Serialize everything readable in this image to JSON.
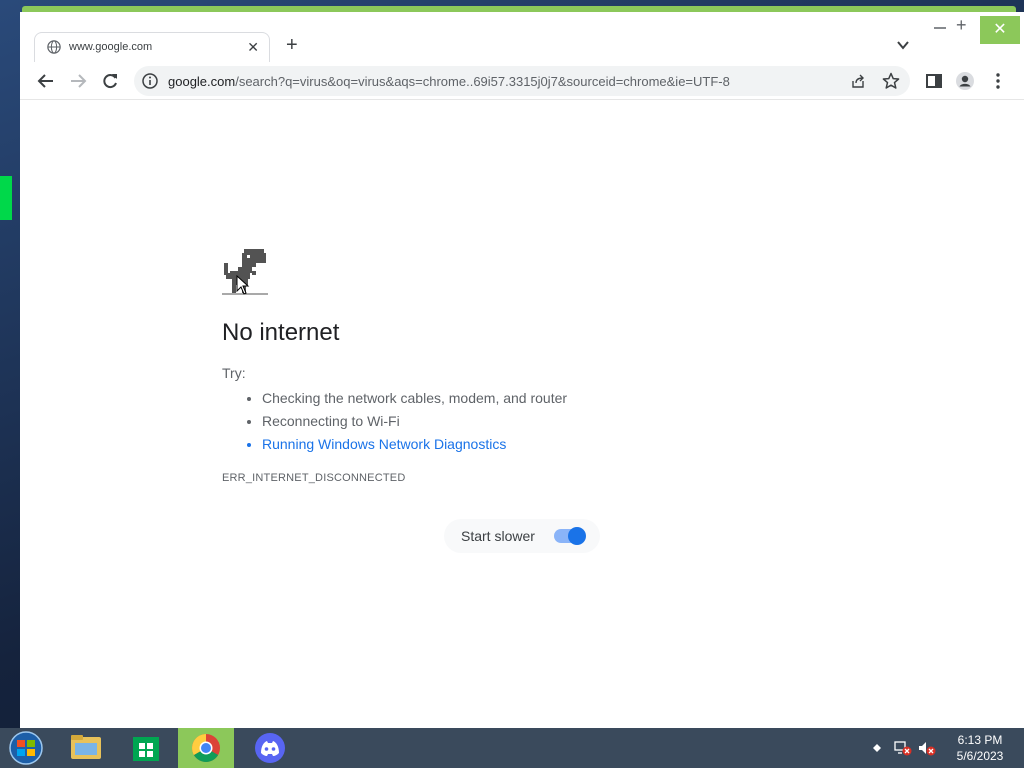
{
  "browser": {
    "tab": {
      "title": "www.google.com",
      "close_glyph": "✕",
      "icon": "globe-icon"
    },
    "new_tab_glyph": "+",
    "window_controls": {
      "maximize_glyph": "+",
      "close_glyph": "✕"
    },
    "address_bar": {
      "host": "google.com",
      "path": "/search?q=virus&oq=virus&aqs=chrome..69i57.3315j0j7&sourceid=chrome&ie=UTF-8"
    },
    "accent": "#1a73e8"
  },
  "error_page": {
    "title": "No internet",
    "try_label": "Try:",
    "suggestions": [
      "Checking the network cables, modem, and router",
      "Reconnecting to Wi-Fi",
      "Running Windows Network Diagnostics"
    ],
    "error_code": "ERR_INTERNET_DISCONNECTED",
    "start_slower": {
      "label": "Start slower",
      "enabled": true
    }
  },
  "taskbar": {
    "apps": [
      "start-orb",
      "file-explorer",
      "windows-store",
      "chrome",
      "discord"
    ],
    "active_app": "chrome",
    "tray_icons": [
      "show-hidden-icons",
      "network-disconnected-icon",
      "volume-muted-icon"
    ],
    "time": "6:13 PM",
    "date": "5/6/2023"
  }
}
